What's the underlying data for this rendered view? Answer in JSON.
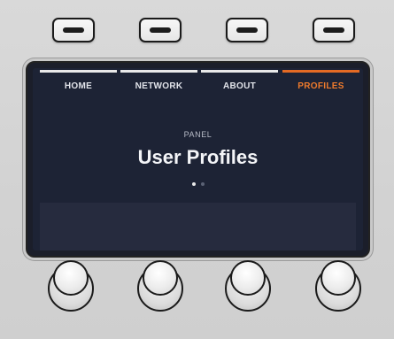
{
  "tabs": [
    {
      "label": "HOME",
      "active": false
    },
    {
      "label": "NETWORK",
      "active": false
    },
    {
      "label": "ABOUT",
      "active": false
    },
    {
      "label": "PROFILES",
      "active": true
    }
  ],
  "screen": {
    "subtitle": "PANEL",
    "title": "User Profiles",
    "page_count": 2,
    "current_page": 1
  },
  "colors": {
    "accent": "#e46a24",
    "screen_bg": "#1d2335",
    "panel_bg": "#d6d6d6"
  },
  "controls": {
    "softkeys": [
      "softkey-1",
      "softkey-2",
      "softkey-3",
      "softkey-4"
    ],
    "knobs": [
      "knob-1",
      "knob-2",
      "knob-3",
      "knob-4"
    ]
  }
}
